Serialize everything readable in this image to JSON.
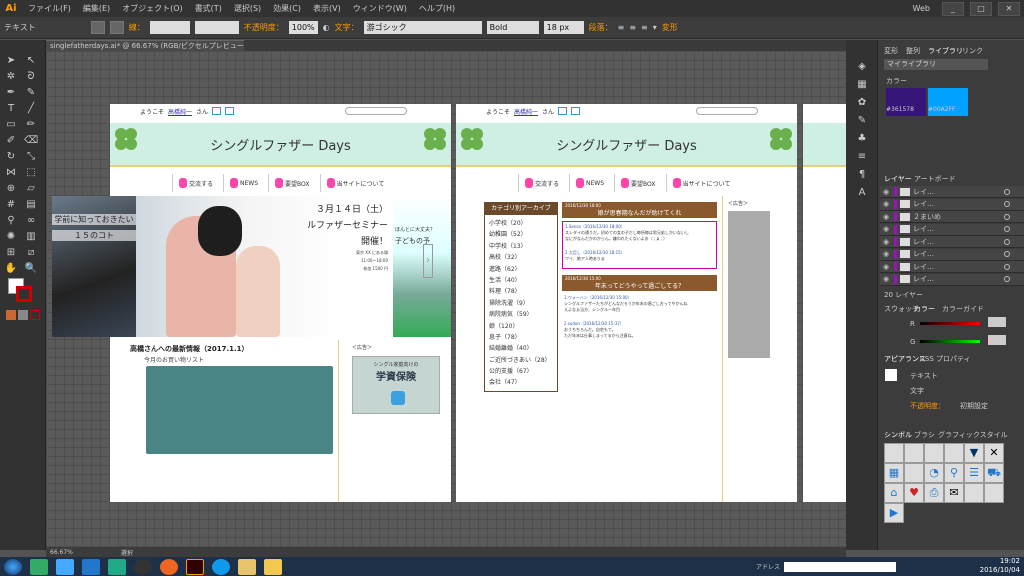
{
  "app": {
    "logo": "Ai",
    "menu": [
      "ファイル(F)",
      "編集(E)",
      "オブジェクト(O)",
      "書式(T)",
      "選択(S)",
      "効果(C)",
      "表示(V)",
      "ウィンドウ(W)",
      "ヘルプ(H)"
    ],
    "workspace": "Web"
  },
  "control": {
    "text_label": "テキスト",
    "stroke_label": "線：",
    "opacity_label": "不透明度：",
    "opacity_value": "100%",
    "char_label": "文字：",
    "font_value": "游ゴシック",
    "style_value": "Bold",
    "size_value": "18 px",
    "para_label": "段落：",
    "transform_label": "変形"
  },
  "document": {
    "tab": "singlefatherdays.ai* @ 66.67% (RGB/ピクセルプレビュー)",
    "zoom": "66.67%",
    "status_mode": "選択"
  },
  "page1": {
    "welcome": "ようこそ",
    "user": "高橋純一",
    "san": "さん",
    "title": "シングルファザー Days",
    "nav": [
      "交流する",
      "NEWS",
      "要望BOX",
      "当サイトについて"
    ],
    "slide_left": [
      "学前に知っておきたい",
      "１５のコト"
    ],
    "seminar_date": "３月１４日（土）",
    "seminar_title": "ルファザーセミナー",
    "seminar_open": "開催！",
    "seminar_detail": [
      "東京 XX にある場",
      "11:00～18:00",
      "参加 1500 円"
    ],
    "slide_right": [
      "ほんとに大丈夫？",
      "子どもの予"
    ],
    "news_title": "高橋さんへの最新情報（2017.1.1）",
    "news_sub": "今月のお買い物リスト",
    "ad_label": "＜広告＞",
    "ad_line1": "シングル家庭向けの",
    "ad_line2": "学資保険"
  },
  "page2": {
    "welcome": "ようこそ",
    "user": "高橋純一",
    "san": "さん",
    "title": "シングルファザー Days",
    "nav": [
      "交流する",
      "NEWS",
      "要望BOX",
      "当サイトについて"
    ],
    "archive_title": "カテゴリ別アーカイブ",
    "archive": [
      "小学校（20）",
      "幼稚園（52）",
      "中学校（13）",
      "高校（32）",
      "進路（62）",
      "生活（40）",
      "料理（78）",
      "掃除洗濯（9）",
      "病院病気（59）",
      "娘（120）",
      "息子（78）",
      "結婚離婚（40）",
      "ご近所づきあい（28）",
      "公的支援（67）",
      "会社（47）"
    ],
    "post1_date": "2016/12/30 18:00",
    "post1_title": "娘が思春期なんだが助けてくれ",
    "post1_c1": "1.Sensa（2016/12/30 18:00）",
    "post1_c1_text": [
      "スレタイの通りだ。初めての女の子だし毎所毎は男兄弟しかいないし",
      "なにがなんだかわからん。嫌われたくないよお（ ; д ; ）"
    ],
    "post1_c2": "2.大臣し（2016/12/30 18:15）",
    "post1_c2_text": "ワイ、娘ア人時ありま",
    "post2_date": "2016/12/30 15:00",
    "post2_title": "年末ってどうやって過ごしてる？",
    "post2_c1": "1.ウォーハン（2016/12/30 15:00）",
    "post2_c1_text": [
      "シングルファザーたちがどんなだろうか年末の過ごし方ってやかんね",
      "えよなぁ当方、シングル一年目"
    ],
    "post2_c2": "2.sudon（2016/12/30 15:37）",
    "post2_c2_text": [
      "おうちちろんだ。自宅もて。",
      "ただ年末は仕事しまってるから注意ね。"
    ],
    "ad_label": "＜広告＞"
  },
  "panels": {
    "tabs_top": [
      "変形",
      "整列",
      "ライブラリ",
      "リンク"
    ],
    "library_name": "マイライブラリ",
    "colors_label": "カラー",
    "swatch1": "#361578",
    "swatch2": "#00A2FF",
    "layer_tabs": [
      "レイヤー",
      "アートボード"
    ],
    "layers": [
      "レイ…",
      "レイ…",
      "２まいめ",
      "レイ…",
      "レイ…",
      "レイ…",
      "レイ…",
      "レイ…"
    ],
    "layer_count": "20 レイヤー",
    "color_tabs": [
      "スウォッチ",
      "カラー",
      "カラーガイド"
    ],
    "color_rows": [
      "R",
      "G"
    ],
    "appearance_tabs": [
      "アピアランス",
      "CSS プロパティ"
    ],
    "appearance_title": "テキスト",
    "appearance_char": "文字",
    "appearance_opacity": "不透明度：",
    "appearance_opacity_val": "初期設定",
    "symbol_tabs": [
      "シンボル",
      "ブラシ",
      "グラフィックスタイル"
    ]
  },
  "taskbar": {
    "address_label": "アドレス",
    "time": "19:02",
    "date": "2016/10/04"
  }
}
